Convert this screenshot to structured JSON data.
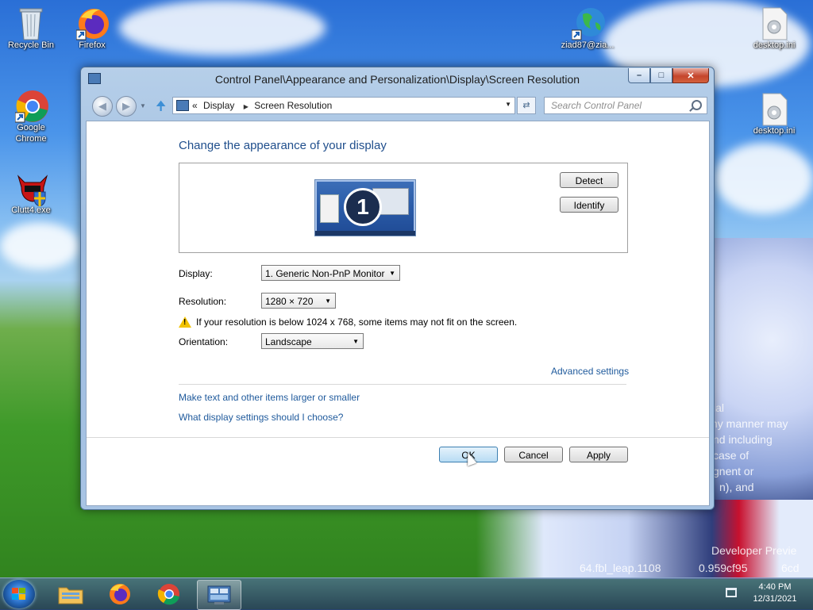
{
  "desktop": {
    "icons": [
      {
        "label": "Recycle Bin",
        "icon": "recycle-bin-icon"
      },
      {
        "label": "Firefox",
        "icon": "firefox-icon"
      },
      {
        "label": "ziad87@zia...",
        "icon": "globe-icon"
      },
      {
        "label": "desktop.ini",
        "icon": "settings-file-icon"
      },
      {
        "label": "Google Chrome",
        "icon": "chrome-icon"
      },
      {
        "label": "desktop.ini",
        "icon": "settings-file-icon"
      },
      {
        "label": "Clutt4.exe",
        "icon": "devil-shield-icon"
      }
    ],
    "overlay_text": [
      "ial",
      "ny manner may",
      "nd including",
      "case of",
      "gnent or",
      "n), and",
      "Developer Previe",
      "64.fbl_leap.1108",
      "0.959cf95",
      "6cd"
    ]
  },
  "window": {
    "title": "Control Panel\\Appearance and Personalization\\Display\\Screen Resolution",
    "caption": {
      "minimize": "–",
      "maximize": "□",
      "close": "✕"
    },
    "address": {
      "crumb_prefix": "«",
      "crumbs": [
        "Display",
        "Screen Resolution"
      ]
    },
    "search": {
      "placeholder": "Search Control Panel"
    }
  },
  "content": {
    "heading": "Change the appearance of your display",
    "monitor_number": "1",
    "detect_label": "Detect",
    "identify_label": "Identify",
    "display": {
      "label": "Display:",
      "value": "1. Generic Non-PnP Monitor"
    },
    "resolution": {
      "label": "Resolution:",
      "value": "1280 × 720"
    },
    "warning": "If your resolution is below 1024 x 768, some items may not fit on the screen.",
    "orientation": {
      "label": "Orientation:",
      "value": "Landscape"
    },
    "advanced_link": "Advanced settings",
    "links": [
      "Make text and other items larger or smaller",
      "What display settings should I choose?"
    ],
    "buttons": {
      "ok": "OK",
      "cancel": "Cancel",
      "apply": "Apply"
    }
  },
  "taskbar": {
    "items": [
      "start-button",
      "file-explorer-icon",
      "firefox-icon",
      "chrome-icon",
      "control-panel-icon"
    ],
    "time": "4:40 PM",
    "date": "12/31/2021"
  },
  "colors": {
    "link": "#1f5a9c",
    "heading": "#1f4e8c",
    "close_button": "#c5452c",
    "primary_button": "#b8dcf4"
  }
}
